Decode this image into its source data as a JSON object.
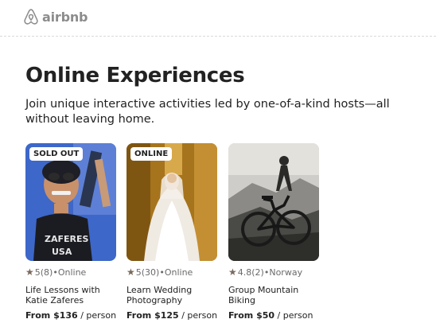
{
  "brand": {
    "name": "airbnb",
    "icon": "airbnb-logo-icon"
  },
  "page": {
    "title": "Online Experiences",
    "subtitle": "Join unique interactive activities led by one-of-a-kind hosts—all without leaving home."
  },
  "cards": [
    {
      "badge": "SOLD OUT",
      "rating": "5",
      "reviews": "(8)",
      "location": "•Online",
      "title": "Life Lessons with Katie Zaferes",
      "price": "From $136",
      "per": " / person"
    },
    {
      "badge": "ONLINE",
      "rating": "5",
      "reviews": "(30)",
      "location": "•Online",
      "title": "Learn Wedding Photography",
      "price": "From $125",
      "per": " / person"
    },
    {
      "badge": "",
      "rating": "4.8",
      "reviews": "(2)",
      "location": "•Norway",
      "title": "Group Mountain Biking",
      "price": "From $50",
      "per": " / person"
    }
  ],
  "colors": {
    "brand_gray": "#8c8c8c",
    "text": "#222222",
    "star": "#7a6a5c"
  }
}
